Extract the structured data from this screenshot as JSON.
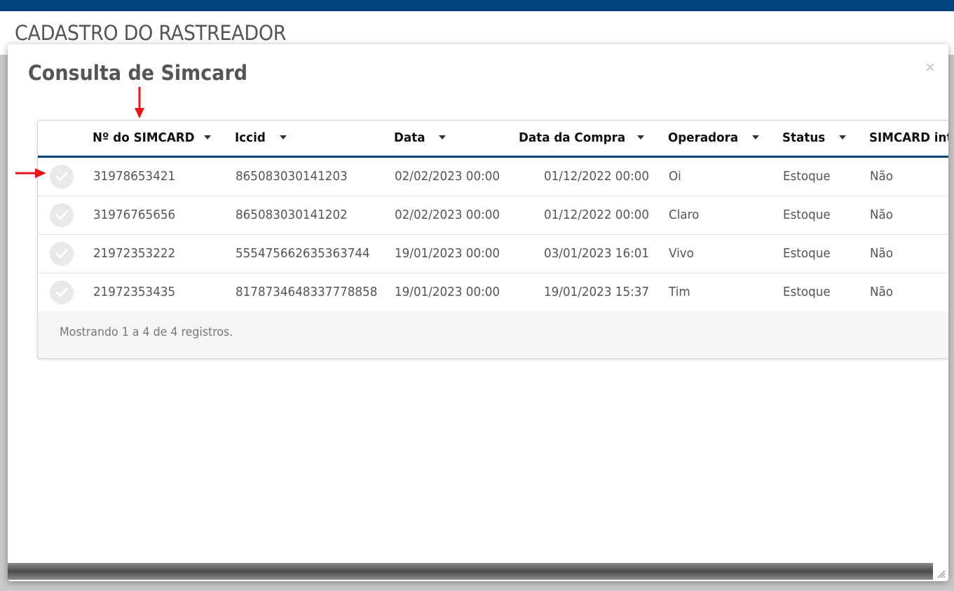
{
  "page": {
    "title": "CADASTRO DO RASTREADOR"
  },
  "modal": {
    "title": "Consulta de Simcard",
    "close_label": "×",
    "icons": {
      "close": "close-icon",
      "select": "checkmark-icon",
      "sort": "caret-down-icon"
    },
    "colors": {
      "accent": "#00447f",
      "annotation": "#e8141b"
    }
  },
  "table": {
    "columns": [
      {
        "label": "Nº do SIMCARD"
      },
      {
        "label": "Iccid"
      },
      {
        "label": "Data"
      },
      {
        "label": "Data da Compra"
      },
      {
        "label": "Operadora"
      },
      {
        "label": "Status"
      },
      {
        "label": "SIMCARD int"
      }
    ],
    "rows": [
      {
        "simcard": "31978653421",
        "iccid": "865083030141203",
        "data": "02/02/2023 00:00",
        "data_compra": "01/12/2022 00:00",
        "operadora": "Oi",
        "status": "Estoque",
        "simcard_int": "Não"
      },
      {
        "simcard": "31976765656",
        "iccid": "865083030141202",
        "data": "02/02/2023 00:00",
        "data_compra": "01/12/2022 00:00",
        "operadora": "Claro",
        "status": "Estoque",
        "simcard_int": "Não"
      },
      {
        "simcard": "21972353222",
        "iccid": "555475662635363744",
        "data": "19/01/2023 00:00",
        "data_compra": "03/01/2023 16:01",
        "operadora": "Vivo",
        "status": "Estoque",
        "simcard_int": "Não"
      },
      {
        "simcard": "21972353435",
        "iccid": "8178734648337778858",
        "data": "19/01/2023 00:00",
        "data_compra": "19/01/2023 15:37",
        "operadora": "Tim",
        "status": "Estoque",
        "simcard_int": "Não"
      }
    ],
    "footer": "Mostrando 1 a 4 de 4 registros."
  }
}
